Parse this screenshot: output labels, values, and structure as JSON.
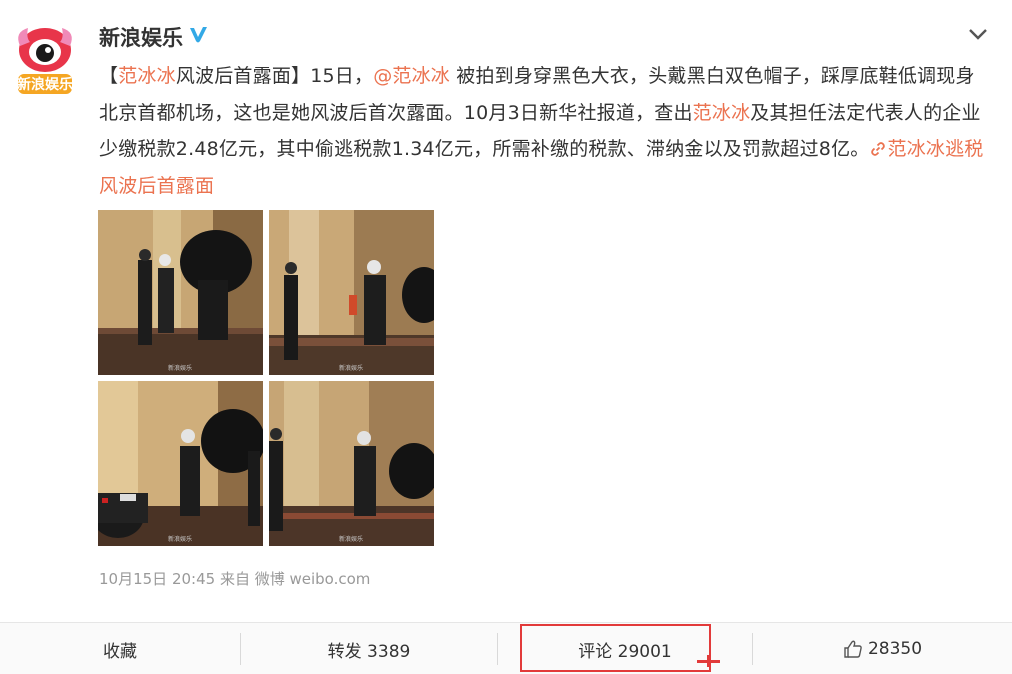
{
  "post": {
    "author": "新浪娱乐",
    "text_parts": {
      "p1": "【",
      "tag_name": "范冰冰",
      "p2": "风波后首露面】15日，",
      "mention": "@范冰冰",
      "p3": " 被拍到身穿黑色大衣，头戴黑白双色帽子，踩厚底鞋低调现身北京首都机场，这也是她风波后首次露面。10月3日新华社报道，查出",
      "name2": "范冰冰",
      "p4": "及其担任法定代表人的企业少缴税款2.48亿元，其中偷逃税款1.34亿元，所需补缴的税款、滞纳金以及罚款超过8亿。",
      "topic_link": "范冰冰逃税风波后首露面"
    },
    "meta": "10月15日 20:45 来自 微博 weibo.com",
    "photo_watermark": "新浪娱乐"
  },
  "actions": {
    "favorite": "收藏",
    "repost": "转发 3389",
    "comment": "评论 29001",
    "like_count": "28350"
  },
  "colors": {
    "accent": "#eb7350",
    "verified": "#33a9e6",
    "highlight_box": "#e23a3a"
  },
  "icons": [
    "avatar-logo",
    "verified-icon",
    "chevron-down-icon",
    "link-icon",
    "thumbs-up-icon"
  ]
}
